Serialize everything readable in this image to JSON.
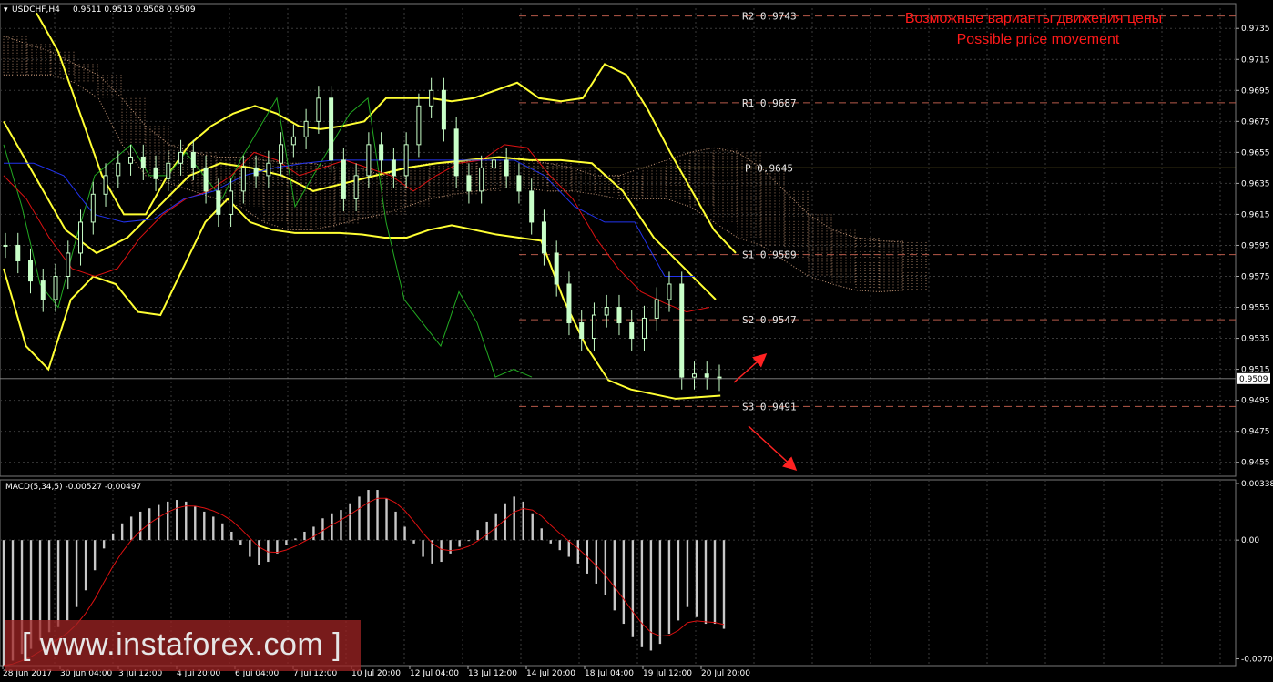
{
  "header": {
    "symbol_label": "USDCHF,H4",
    "ohlc": "0.9511 0.9513 0.9508 0.9509",
    "macd_label": "MACD(5,34,5) -0.00527 -0.00497"
  },
  "annotation": {
    "line1": "Возможные варианты движения цены",
    "line2": "Possible price movement",
    "color": "#ff1a1a"
  },
  "watermark_text": "[ www.instaforex.com ]",
  "colors": {
    "background": "#000000",
    "grid": "#3a3a3a",
    "bands": "#ffff33",
    "green_line": "#22aa22",
    "red_line": "#dd1111",
    "blue_line": "#2233ee",
    "cloud": "#c89a7a",
    "candle": "#c8ffc8",
    "pivot": "#d4b84a",
    "levels": "#b65a4a",
    "arrow": "#ff2222",
    "histogram": "#c8c8c8",
    "signal": "#dd1111"
  },
  "chart_data": [
    {
      "type": "candlestick",
      "title": "USDCHF,H4",
      "yaxis_ticks": [
        "0.9735",
        "0.9715",
        "0.9695",
        "0.9675",
        "0.9655",
        "0.9635",
        "0.9615",
        "0.9595",
        "0.9575",
        "0.9555",
        "0.9535",
        "0.9515",
        "0.9495",
        "0.9475",
        "0.9455"
      ],
      "ylim": [
        0.9446,
        0.9751
      ],
      "current_price": "0.9509",
      "x_labels": [
        "28 Jun 2017",
        "30 Jun 04:00",
        "3 Jul 12:00",
        "4 Jul 20:00",
        "6 Jul 04:00",
        "7 Jul 12:00",
        "10 Jul 20:00",
        "12 Jul 04:00",
        "13 Jul 12:00",
        "14 Jul 20:00",
        "18 Jul 04:00",
        "19 Jul 12:00",
        "20 Jul 20:00"
      ],
      "levels": [
        {
          "label": "R2",
          "value": "0.9743"
        },
        {
          "label": "R1",
          "value": "0.9687"
        },
        {
          "label": "P",
          "value": "0.9645"
        },
        {
          "label": "S1",
          "value": "0.9589"
        },
        {
          "label": "S2",
          "value": "0.9547"
        },
        {
          "label": "S3",
          "value": "0.9491"
        }
      ],
      "close_path": [
        0.9595,
        0.9585,
        0.9572,
        0.956,
        0.9575,
        0.959,
        0.961,
        0.9628,
        0.964,
        0.9648,
        0.9652,
        0.9645,
        0.9638,
        0.9648,
        0.9655,
        0.9645,
        0.963,
        0.9615,
        0.963,
        0.9645,
        0.964,
        0.9648,
        0.966,
        0.9665,
        0.9675,
        0.969,
        0.965,
        0.9625,
        0.964,
        0.966,
        0.965,
        0.964,
        0.966,
        0.9685,
        0.9695,
        0.967,
        0.964,
        0.963,
        0.9645,
        0.965,
        0.964,
        0.963,
        0.961,
        0.959,
        0.957,
        0.9545,
        0.9535,
        0.955,
        0.9555,
        0.9545,
        0.9535,
        0.9548,
        0.956,
        0.957,
        0.951,
        0.9512,
        0.951,
        0.9509
      ],
      "upper_band": [
        0.9745,
        0.972,
        0.968,
        0.964,
        0.9615,
        0.9615,
        0.964,
        0.966,
        0.9672,
        0.968,
        0.9685,
        0.968,
        0.9672,
        0.967,
        0.9672,
        0.9675,
        0.969,
        0.969,
        0.969,
        0.9688,
        0.969,
        0.9695,
        0.97,
        0.969,
        0.9688,
        0.969,
        0.9712,
        0.9705,
        0.9682,
        0.9655,
        0.963,
        0.9605,
        0.959
      ],
      "middle_band": [
        0.9675,
        0.964,
        0.9605,
        0.959,
        0.96,
        0.962,
        0.964,
        0.9648,
        0.9645,
        0.964,
        0.963,
        0.9635,
        0.964,
        0.9645,
        0.9648,
        0.965,
        0.9652,
        0.965,
        0.965,
        0.9648,
        0.963,
        0.96,
        0.958,
        0.956
      ],
      "lower_band": [
        0.958,
        0.953,
        0.9515,
        0.956,
        0.9575,
        0.957,
        0.9552,
        0.955,
        0.958,
        0.961,
        0.9625,
        0.961,
        0.9605,
        0.9603,
        0.9603,
        0.9603,
        0.9602,
        0.96,
        0.96,
        0.9605,
        0.9608,
        0.9605,
        0.9602,
        0.96,
        0.9598,
        0.956,
        0.953,
        0.9508,
        0.9502,
        0.9499,
        0.9496,
        0.9497,
        0.9498
      ]
    },
    {
      "type": "bar",
      "title": "MACD(5,34,5)",
      "yaxis_ticks": [
        "0.00338",
        "0.00",
        "-0.00709"
      ],
      "ylim": [
        -0.0075,
        0.0036
      ],
      "values": [
        -0.0075,
        -0.0072,
        -0.0068,
        -0.0065,
        -0.006,
        -0.0055,
        -0.0052,
        -0.0048,
        -0.004,
        -0.003,
        -0.0018,
        -0.0005,
        0.0004,
        0.001,
        0.0014,
        0.0017,
        0.0019,
        0.0021,
        0.0023,
        0.0024,
        0.0023,
        0.002,
        0.0017,
        0.0014,
        0.001,
        0.0005,
        -0.0003,
        -0.001,
        -0.0015,
        -0.0013,
        -0.0008,
        -0.0003,
        0.0001,
        0.0005,
        0.0008,
        0.0013,
        0.0016,
        0.0018,
        0.0022,
        0.0026,
        0.003,
        0.003,
        0.0025,
        0.0017,
        0.0008,
        -0.0002,
        -0.001,
        -0.0014,
        -0.0013,
        -0.0008,
        -0.0004,
        0.0,
        0.0006,
        0.0011,
        0.0016,
        0.0022,
        0.0026,
        0.0023,
        0.0016,
        0.0007,
        -0.0002,
        -0.0006,
        -0.001,
        -0.0014,
        -0.002,
        -0.0026,
        -0.0033,
        -0.0042,
        -0.005,
        -0.0058,
        -0.0064,
        -0.0066,
        -0.0062,
        -0.0056,
        -0.0048,
        -0.004,
        -0.0046,
        -0.005,
        -0.005,
        -0.0053
      ]
    }
  ]
}
